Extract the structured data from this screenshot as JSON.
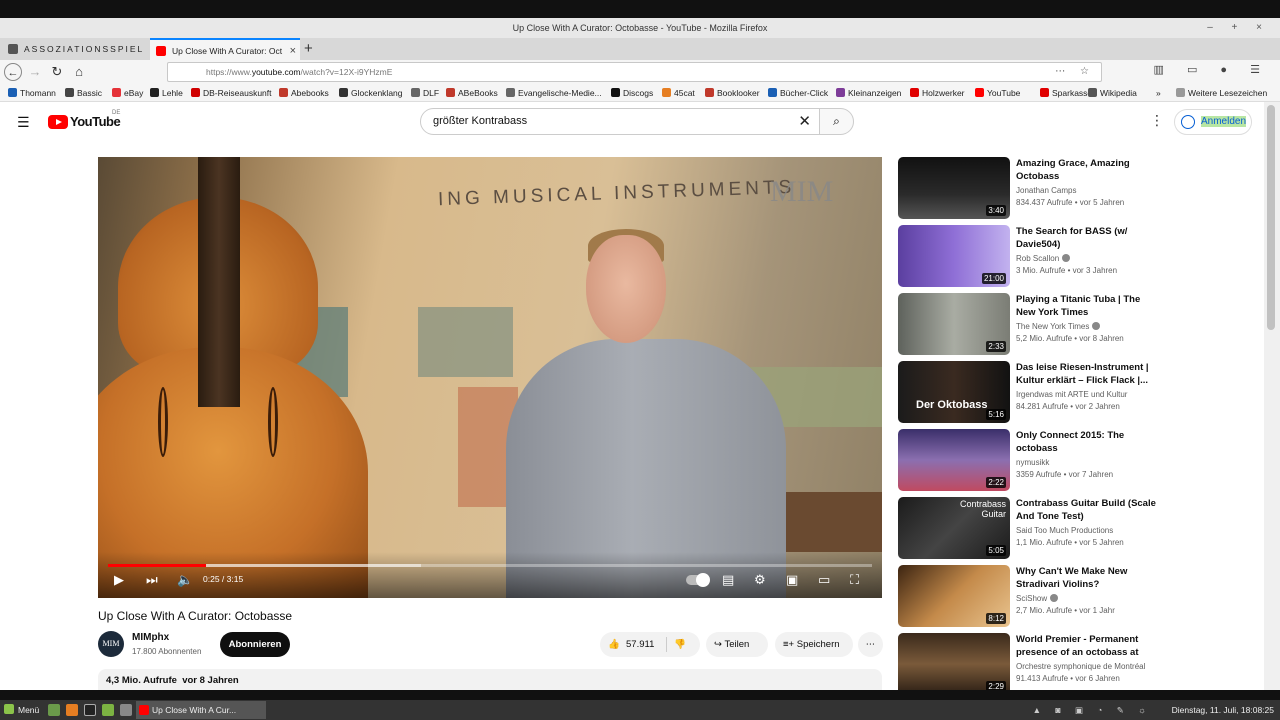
{
  "window": {
    "title": "Up Close With A Curator: Octobasse - YouTube - Mozilla Firefox",
    "controls": "– + ×"
  },
  "tabs": [
    {
      "label": "ASSOZIATIONSSPIEL",
      "active": false
    },
    {
      "label": "Up Close With A Curator: Oct",
      "active": true
    }
  ],
  "newtab_label": "+",
  "nav": {
    "back": "←",
    "forward": "→",
    "reload": "↻",
    "home": "⌂",
    "url_prefix": "https://www.",
    "url_domain": "youtube.com",
    "url_path": "/watch?v=12X-i9YHzmE",
    "url_icons": "⋯ ☆"
  },
  "bookmarks": [
    {
      "label": "Thomann",
      "color": "#1a5fb4"
    },
    {
      "label": "Bassic",
      "color": "#444444"
    },
    {
      "label": "eBay",
      "color": "#e53238"
    },
    {
      "label": "Lehle",
      "color": "#222222"
    },
    {
      "label": "DB-Reiseauskunft",
      "color": "#d00000"
    },
    {
      "label": "Abebooks",
      "color": "#c0392b"
    },
    {
      "label": "Glockenklang",
      "color": "#333333"
    },
    {
      "label": "DLF",
      "color": "#666666"
    },
    {
      "label": "ABeBooks",
      "color": "#c0392b"
    },
    {
      "label": "Evangelische-Medie...",
      "color": "#666666"
    },
    {
      "label": "Discogs",
      "color": "#111111"
    },
    {
      "label": "45cat",
      "color": "#e67e22"
    },
    {
      "label": "Booklooker",
      "color": "#c0392b"
    },
    {
      "label": "Bücher-Click",
      "color": "#1a5fb4"
    },
    {
      "label": "Kleinanzeigen",
      "color": "#7d3c98"
    },
    {
      "label": "Holzwerker",
      "color": "#e00000"
    },
    {
      "label": "YouTube",
      "color": "#ff0000"
    },
    {
      "label": "Sparkasse",
      "color": "#e00000"
    },
    {
      "label": "Wikipedia",
      "color": "#555555"
    }
  ],
  "bookmarks_overflow": "»",
  "bookmarks_other": "Weitere Lesezeichen",
  "youtube": {
    "logo_text": "YouTube",
    "logo_region": "DE",
    "search_value": "größter Kontrabass",
    "signin_label": "Anmelden"
  },
  "video": {
    "title": "Up Close With A Curator: Octobasse",
    "overlay_text": "ING MUSICAL INSTRUMENTS",
    "watermark": "MIM",
    "time_current": "0:25",
    "time_total": "3:15",
    "progress_fraction": 0.128,
    "buffered_fraction": 0.41
  },
  "channel": {
    "name": "MIMphx",
    "avatar_text": "MIM",
    "subscribers": "17.800 Abonnenten",
    "subscribe_label": "Abonnieren"
  },
  "actions": {
    "likes": "57.911",
    "share_label": "Teilen",
    "save_label": "Speichern",
    "more": "⋯"
  },
  "description": {
    "views": "4,3 Mio. Aufrufe",
    "age": "vor 8 Jahren"
  },
  "related": [
    {
      "title": "Amazing Grace, Amazing Octobass",
      "channel": "Jonathan Camps",
      "verified": false,
      "views": "834.437 Aufrufe",
      "age": "vor 5 Jahren",
      "duration": "3:40",
      "thumb_bg": "linear-gradient(180deg,#111 0%,#2a2a2a 60%,#555 100%)",
      "thumb_text": ""
    },
    {
      "title": "The Search for BASS (w/ Davie504)",
      "channel": "Rob Scallon",
      "verified": true,
      "views": "3 Mio. Aufrufe",
      "age": "vor 3 Jahren",
      "duration": "21:00",
      "thumb_bg": "linear-gradient(90deg,#5b3fa0 0%,#8f6fd6 50%,#c2b2ef 100%)",
      "thumb_text": ""
    },
    {
      "title": "Playing a Titanic Tuba | The New York Times",
      "channel": "The New York Times",
      "verified": true,
      "views": "5,2 Mio. Aufrufe",
      "age": "vor 8 Jahren",
      "duration": "2:33",
      "thumb_bg": "linear-gradient(90deg,#5e625c 0%,#a9aca3 50%,#7b7d75 100%)",
      "thumb_text": ""
    },
    {
      "title": "Das leise Riesen-Instrument | Kultur erklärt – Flick Flack |...",
      "channel": "Irgendwas mit ARTE und Kultur",
      "verified": false,
      "views": "84.281 Aufrufe",
      "age": "vor 2 Jahren",
      "duration": "5:16",
      "thumb_bg": "linear-gradient(90deg,#1b1b1b 0%,#3a2a20 50%,#121212 100%)",
      "thumb_text": "Der Oktobass"
    },
    {
      "title": "Only Connect 2015: The octobass",
      "channel": "nymusikk",
      "verified": false,
      "views": "3359 Aufrufe",
      "age": "vor 7 Jahren",
      "duration": "2:22",
      "thumb_bg": "linear-gradient(180deg,#3a2f6a 0%,#8b6fb0 50%,#c04a60 100%)",
      "thumb_text": ""
    },
    {
      "title": "Contrabass Guitar Build (Scale And Tone Test)",
      "channel": "Said Too Much Productions",
      "verified": false,
      "views": "1,1 Mio. Aufrufe",
      "age": "vor 5 Jahren",
      "duration": "5:05",
      "thumb_bg": "linear-gradient(135deg,#1b1b1b 0%,#444 50%,#1b1b1b 100%)",
      "thumb_text": "Contrabass Guitar"
    },
    {
      "title": "Why Can't We Make New Stradivari Violins?",
      "channel": "SciShow",
      "verified": true,
      "views": "2,7 Mio. Aufrufe",
      "age": "vor 1 Jahr",
      "duration": "8:12",
      "thumb_bg": "linear-gradient(135deg,#3c2411 0%,#c48a4a 50%,#e9c48f 100%)",
      "thumb_text": ""
    },
    {
      "title": "World Premier - Permanent presence of an octobass at th...",
      "channel": "Orchestre symphonique de Montréal",
      "verified": false,
      "views": "91.413 Aufrufe",
      "age": "vor 6 Jahren",
      "duration": "2:29",
      "thumb_bg": "linear-gradient(180deg,#3b2a1c 0%,#7a5a3a 50%,#2a1e14 100%)",
      "thumb_text": ""
    }
  ],
  "taskbar": {
    "menu_label": "Menü",
    "task_label": "Up Close With A Cur...",
    "clock": "Dienstag, 11. Juli, 18:08:25"
  }
}
